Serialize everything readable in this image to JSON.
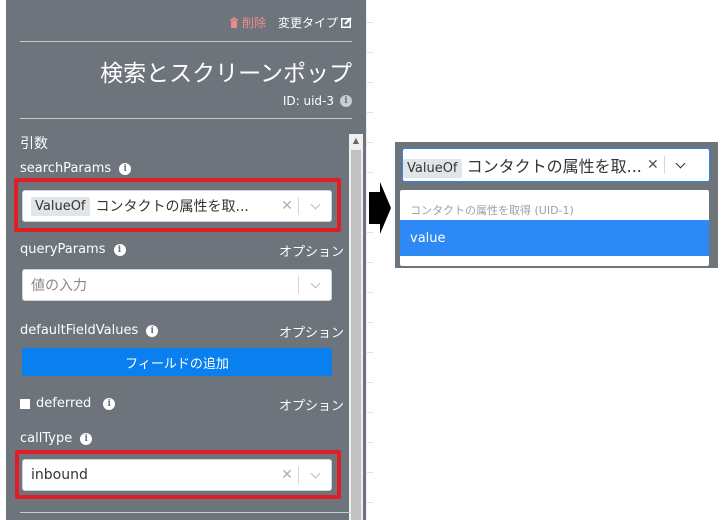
{
  "toolbar": {
    "delete_label": "削除",
    "change_type_label": "変更タイプ"
  },
  "block": {
    "title": "検索とスクリーンポップ",
    "id_label": "ID: uid-3"
  },
  "section": {
    "args_label": "引数"
  },
  "params": {
    "searchParams": {
      "label": "searchParams",
      "tag": "ValueOf",
      "value": "コンタクトの属性を取..."
    },
    "queryParams": {
      "label": "queryParams",
      "optional": "オプション",
      "placeholder": "値の入力"
    },
    "defaultFieldValues": {
      "label": "defaultFieldValues",
      "optional": "オプション",
      "button": "フィールドの追加"
    },
    "deferred": {
      "label": "deferred",
      "optional": "オプション"
    },
    "callType": {
      "label": "callType",
      "value": "inbound"
    }
  },
  "popup": {
    "tag": "ValueOf",
    "value": "コンタクトの属性を取...",
    "group_label": "コンタクトの属性を取得 (UID-1)",
    "options": [
      {
        "label": "value",
        "selected": true
      }
    ]
  },
  "icons": [
    "trash-icon",
    "edit-icon",
    "info-icon",
    "clear-icon",
    "chevron-down-icon",
    "arrow-right-icon"
  ],
  "colors": {
    "panel": "#6d747b",
    "accent": "#0a7ff0",
    "highlight": "#e11d25",
    "delete": "#f08a8a"
  }
}
